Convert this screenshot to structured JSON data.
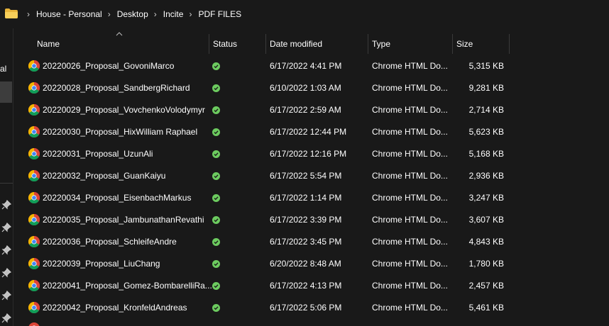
{
  "address": {
    "breadcrumbs": [
      "House - Personal",
      "Desktop",
      "Incite",
      "PDF FILES"
    ],
    "separator": "›"
  },
  "nav_pane": {
    "partial_label": "al"
  },
  "columns": {
    "name": "Name",
    "status": "Status",
    "date": "Date modified",
    "type": "Type",
    "size": "Size"
  },
  "rows": [
    {
      "name": "20220026_Proposal_GovoniMarco",
      "date": "6/17/2022 4:41 PM",
      "type": "Chrome HTML Do...",
      "size": "5,315 KB"
    },
    {
      "name": "20220028_Proposal_SandbergRichard",
      "date": "6/10/2022 1:03 AM",
      "type": "Chrome HTML Do...",
      "size": "9,281 KB"
    },
    {
      "name": "20220029_Proposal_VovchenkoVolodymyr",
      "date": "6/17/2022 2:59 AM",
      "type": "Chrome HTML Do...",
      "size": "2,714 KB"
    },
    {
      "name": "20220030_Proposal_HixWilliam Raphael",
      "date": "6/17/2022 12:44 PM",
      "type": "Chrome HTML Do...",
      "size": "5,623 KB"
    },
    {
      "name": "20220031_Proposal_UzunAli",
      "date": "6/17/2022 12:16 PM",
      "type": "Chrome HTML Do...",
      "size": "5,168 KB"
    },
    {
      "name": "20220032_Proposal_GuanKaiyu",
      "date": "6/17/2022 5:54 PM",
      "type": "Chrome HTML Do...",
      "size": "2,936 KB"
    },
    {
      "name": "20220034_Proposal_EisenbachMarkus",
      "date": "6/17/2022 1:14 PM",
      "type": "Chrome HTML Do...",
      "size": "3,247 KB"
    },
    {
      "name": "20220035_Proposal_JambunathanRevathi",
      "date": "6/17/2022 3:39 PM",
      "type": "Chrome HTML Do...",
      "size": "3,607 KB"
    },
    {
      "name": "20220036_Proposal_SchleifeAndre",
      "date": "6/17/2022 3:45 PM",
      "type": "Chrome HTML Do...",
      "size": "4,843 KB"
    },
    {
      "name": "20220039_Proposal_LiuChang",
      "date": "6/20/2022 8:48 AM",
      "type": "Chrome HTML Do...",
      "size": "1,780 KB"
    },
    {
      "name": "20220041_Proposal_Gomez-BombarelliRa...",
      "date": "6/17/2022 4:13 PM",
      "type": "Chrome HTML Do...",
      "size": "2,457 KB"
    },
    {
      "name": "20220042_Proposal_KronfeldAndreas",
      "date": "6/17/2022 5:06 PM",
      "type": "Chrome HTML Do...",
      "size": "5,461 KB"
    }
  ],
  "icons": {
    "file": "chrome-icon",
    "status": "synced-check-icon",
    "folder": "folder-icon",
    "pin": "pin-icon"
  },
  "colors": {
    "background": "#191919",
    "text": "#ffffff",
    "status_green": "#6ccb5f",
    "folder_yellow": "#f4c64a"
  }
}
